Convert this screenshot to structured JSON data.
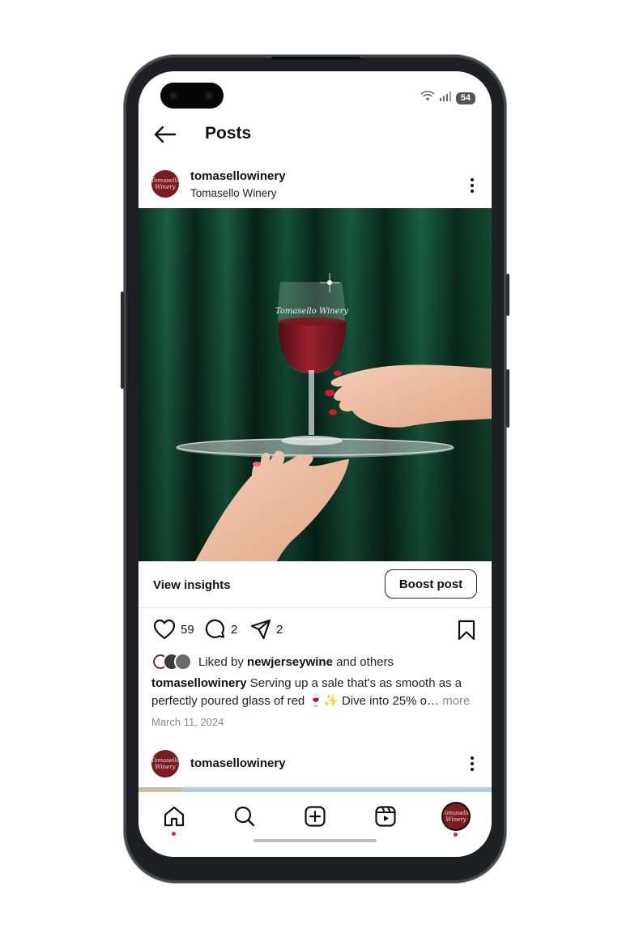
{
  "status_bar": {
    "battery": "54",
    "wifi_icon": "wifi-icon",
    "signal_icon": "signal-icon"
  },
  "header": {
    "title": "Posts",
    "back_icon": "arrow-left-icon"
  },
  "post": {
    "username": "tomasellowinery",
    "display_name": "Tomasello Winery",
    "avatar_text": "Tomasello Winery",
    "image_alt": "Red wine glass on glass tray against green velvet curtain",
    "glass_engraving": "Tomasello Winery",
    "insights_label": "View insights",
    "boost_label": "Boost post",
    "like_count": "59",
    "comment_count": "2",
    "share_count": "2",
    "liked_by_prefix": "Liked by",
    "liked_by_user": "newjerseywine",
    "liked_by_suffix": "and others",
    "caption_user": "tomasellowinery",
    "caption_text": "Serving up a sale that's as smooth as a perfectly poured glass of red 🍷✨ Dive into 25% o…",
    "caption_more": "more",
    "date": "March 11, 2024"
  },
  "next_post": {
    "username": "tomasellowinery",
    "avatar_text": "Tomasello Winery"
  },
  "tabbar": {
    "items": [
      "home-icon",
      "search-icon",
      "create-icon",
      "reels-icon",
      "profile-avatar"
    ]
  },
  "colors": {
    "brand_avatar": "#7a1c22",
    "notification_dot": "#e5223c",
    "curtain": "#0f3d2c"
  }
}
